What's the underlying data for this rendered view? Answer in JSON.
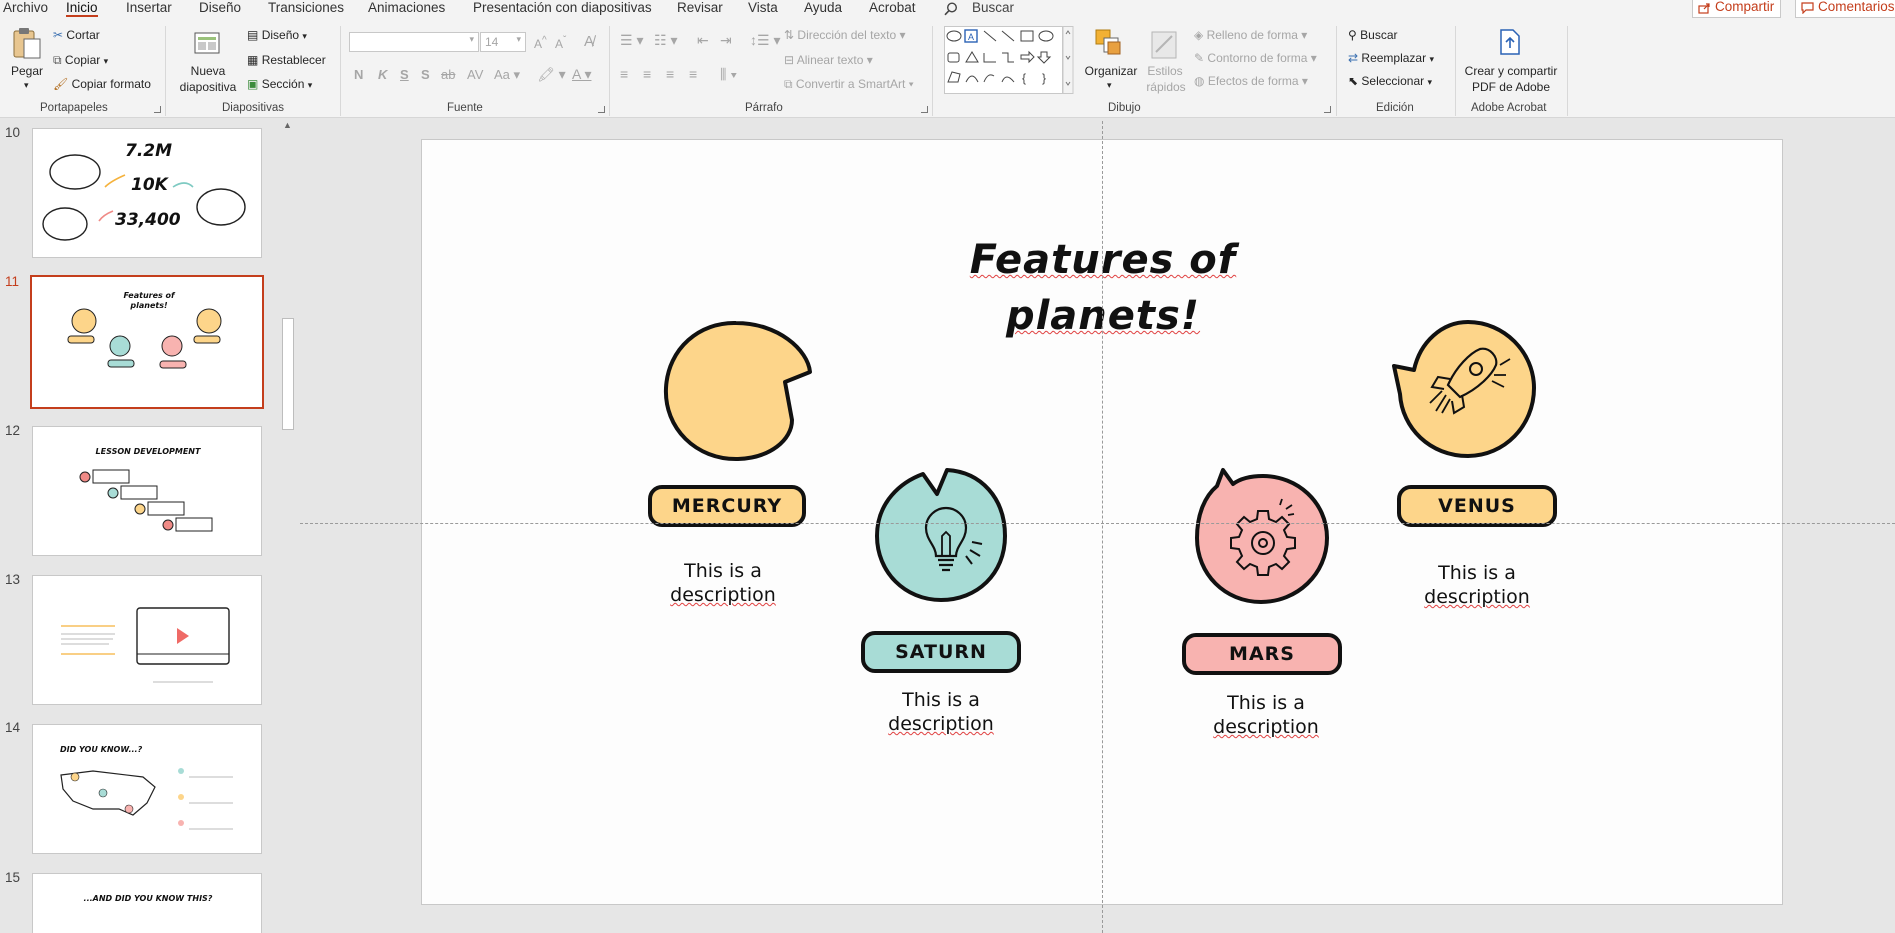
{
  "menu": {
    "tabs": [
      "Archivo",
      "Inicio",
      "Insertar",
      "Diseño",
      "Transiciones",
      "Animaciones",
      "Presentación con diapositivas",
      "Revisar",
      "Vista",
      "Ayuda",
      "Acrobat"
    ],
    "active": "Inicio",
    "search": "Buscar",
    "share": "Compartir",
    "comments": "Comentarios"
  },
  "ribbon": {
    "portapapeles": {
      "label": "Portapapeles",
      "paste": "Pegar",
      "cut": "Cortar",
      "copy": "Copiar",
      "format_painter": "Copiar formato"
    },
    "diapositivas": {
      "label": "Diapositivas",
      "new_slide_1": "Nueva",
      "new_slide_2": "diapositiva",
      "layout": "Diseño",
      "reset": "Restablecer",
      "section": "Sección"
    },
    "fuente": {
      "label": "Fuente",
      "font_name": "",
      "font_size": "14",
      "bold": "N",
      "italic": "K",
      "underline": "S",
      "shadow": "S",
      "strike": "ab",
      "case": "Aa"
    },
    "parrafo": {
      "label": "Párrafo",
      "text_direction": "Dirección del texto",
      "align_text": "Alinear texto",
      "smartart": "Convertir a SmartArt"
    },
    "dibujo": {
      "label": "Dibujo",
      "arrange": "Organizar",
      "quick_styles_1": "Estilos",
      "quick_styles_2": "rápidos",
      "fill": "Relleno de forma",
      "outline": "Contorno de forma",
      "effects": "Efectos de forma"
    },
    "edicion": {
      "label": "Edición",
      "find": "Buscar",
      "replace": "Reemplazar",
      "select": "Seleccionar"
    },
    "acrobat": {
      "label": "Adobe Acrobat",
      "create_1": "Crear y compartir",
      "create_2": "PDF de Adobe"
    }
  },
  "thumbnails": [
    {
      "num": "10",
      "stats": [
        "7.2M",
        "10K",
        "33,400"
      ]
    },
    {
      "num": "11",
      "title": "Features of planets!",
      "selected": true,
      "labels": [
        "Mercury",
        "Saturn",
        "Mars",
        "Venus"
      ]
    },
    {
      "num": "12",
      "title": "Lesson development"
    },
    {
      "num": "13"
    },
    {
      "num": "14",
      "title": "Did you know...?"
    },
    {
      "num": "15",
      "title": "...and did you know this?"
    }
  ],
  "slide": {
    "title_line1": "Features of",
    "title_line2": "planets!",
    "planets": [
      {
        "name": "MERCURY",
        "desc1": "This is a",
        "desc2": "description",
        "color": "#fdd58a",
        "icon": "none"
      },
      {
        "name": "SATURN",
        "desc1": "This is a",
        "desc2": "description",
        "color": "#a8dcd6",
        "icon": "lightbulb-icon"
      },
      {
        "name": "MARS",
        "desc1": "This is a",
        "desc2": "description",
        "color": "#f8b3b0",
        "icon": "gear-icon"
      },
      {
        "name": "VENUS",
        "desc1": "This is a",
        "desc2": "description",
        "color": "#fdd58a",
        "icon": "rocket-icon"
      }
    ]
  }
}
